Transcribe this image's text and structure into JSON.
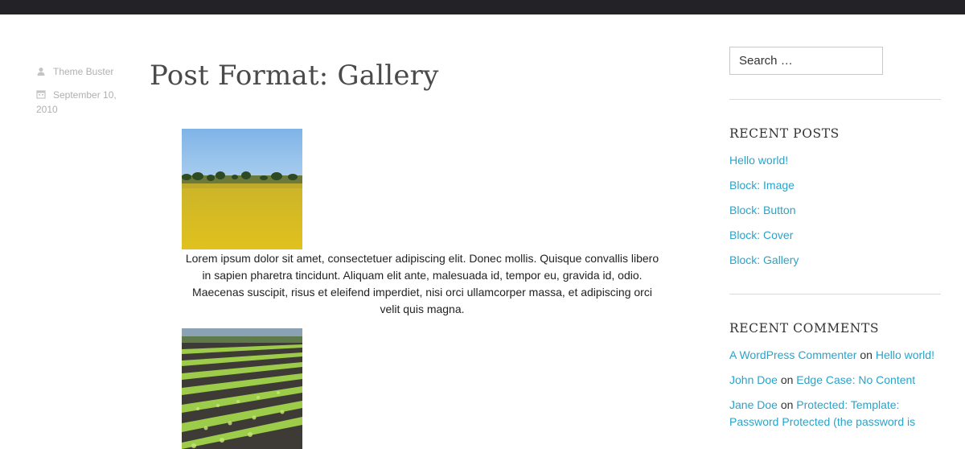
{
  "post": {
    "title": "Post Format: Gallery",
    "author": "Theme Buster",
    "date": "September 10, 2010",
    "caption": "Lorem ipsum dolor sit amet, consectetuer adipiscing elit. Donec mollis. Quisque convallis libero in sapien pharetra tincidunt. Aliquam elit ante, malesuada id, tempor eu, gravida id, odio. Maecenas suscipit, risus et eleifend imperdiet, nisi orci ullamcorper massa, et adipiscing orci velit quis magna."
  },
  "icons": {
    "author": "user-icon",
    "date": "calendar-icon"
  },
  "search": {
    "placeholder": "Search …"
  },
  "recent_posts": {
    "title": "RECENT POSTS",
    "items": [
      "Hello world!",
      "Block: Image",
      "Block: Button",
      "Block: Cover",
      "Block: Gallery"
    ]
  },
  "recent_comments": {
    "title": "RECENT COMMENTS",
    "on_word": "on",
    "items": [
      {
        "author": "A WordPress Commenter",
        "post": "Hello world!"
      },
      {
        "author": "John Doe",
        "post": "Edge Case: No Content"
      },
      {
        "author": "Jane Doe",
        "post": "Protected: Template: Password Protected (the password is"
      }
    ]
  },
  "colors": {
    "topbar": "#232226",
    "link": "#2ba3c9",
    "meta": "#b0b0b0"
  }
}
